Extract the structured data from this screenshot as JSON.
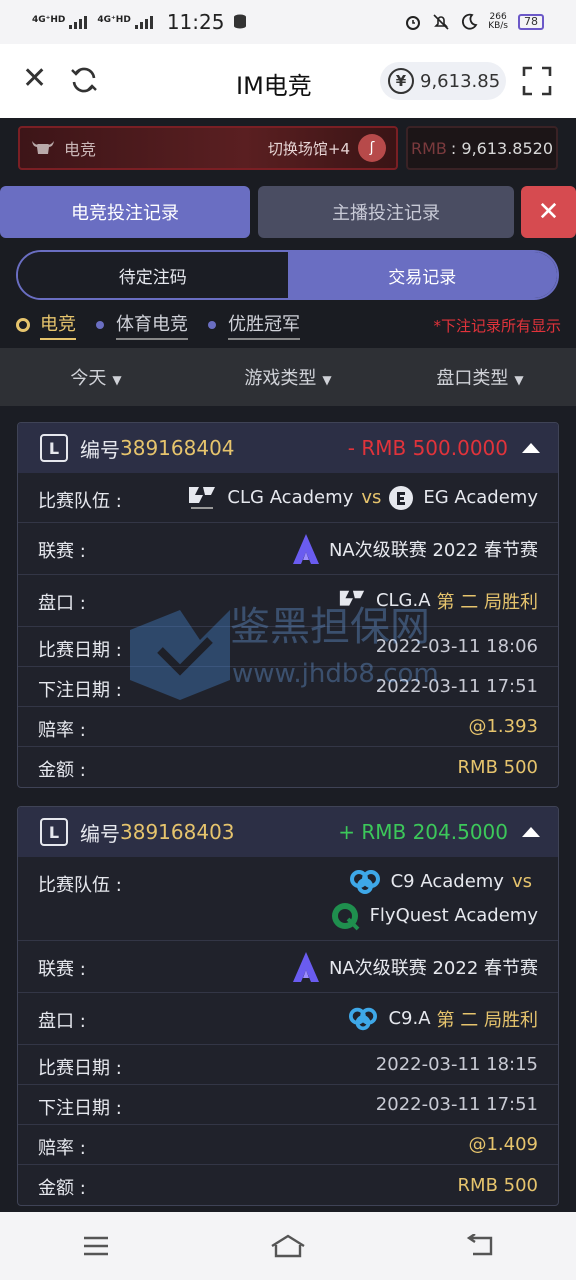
{
  "status": {
    "net1": "4G⁺HD",
    "net2": "4G⁺HD",
    "time": "11:25",
    "speed_value": "266",
    "speed_unit": "KB/s",
    "battery": "78"
  },
  "titlebar": {
    "title": "IM电竞",
    "balance": "9,613.85",
    "currency_symbol": "¥"
  },
  "venue": {
    "name": "电竞",
    "switch_label": "切换场馆+4",
    "switch_icon": "ʃ",
    "rmb_label": "RMB",
    "rmb_value": ": 9,613.8520"
  },
  "tabs": {
    "esports_bets": "电竞投注记录",
    "anchor_bets": "主播投注记录",
    "close": "✕"
  },
  "segments": {
    "pending": "待定注码",
    "history": "交易记录"
  },
  "categories": {
    "items": [
      "电竞",
      "体育电竞",
      "优胜冠军"
    ],
    "note": "*下注记录所有显示"
  },
  "filters": {
    "date": "今天",
    "game_type": "游戏类型",
    "market_type": "盘口类型"
  },
  "cards": [
    {
      "badge": "L",
      "no_label": "编号",
      "no": "389168404",
      "sign": "-",
      "currency": "RMB",
      "amount": "500.0000",
      "direction": "negative",
      "teams_label": "比赛队伍 :",
      "team1": "CLG Academy",
      "vs": "vs",
      "team2": "EG Academy",
      "league_label": "联赛 :",
      "league": "NA次级联赛 2022 春节赛",
      "market_label": "盘口 :",
      "market_team": "CLG.A",
      "market_desc": "第 二 局胜利",
      "match_date_label": "比赛日期 :",
      "match_date": "2022-03-11 18:06",
      "bet_date_label": "下注日期 :",
      "bet_date": "2022-03-11 17:51",
      "odds_label": "赔率 :",
      "odds": "@1.393",
      "stake_label": "金额 :",
      "stake": "RMB 500"
    },
    {
      "badge": "L",
      "no_label": "编号",
      "no": "389168403",
      "sign": "+",
      "currency": "RMB",
      "amount": "204.5000",
      "direction": "positive",
      "teams_label": "比赛队伍 :",
      "team1": "C9 Academy",
      "vs": "vs",
      "team2": "FlyQuest Academy",
      "league_label": "联赛 :",
      "league": "NA次级联赛 2022 春节赛",
      "market_label": "盘口 :",
      "market_team": "C9.A",
      "market_desc": "第 二 局胜利",
      "match_date_label": "比赛日期 :",
      "match_date": "2022-03-11 18:15",
      "bet_date_label": "下注日期 :",
      "bet_date": "2022-03-11 17:51",
      "odds_label": "赔率 :",
      "odds": "@1.409",
      "stake_label": "金额 :",
      "stake": "RMB 500"
    }
  ],
  "watermark": {
    "text": "鉴黑担保网",
    "url": "www.jhdb8.com"
  },
  "colors": {
    "accent": "#6a6ec2",
    "gold": "#e6c46d",
    "negative": "#e0333b",
    "positive": "#3cc85a",
    "close_btn": "#d64b50"
  }
}
